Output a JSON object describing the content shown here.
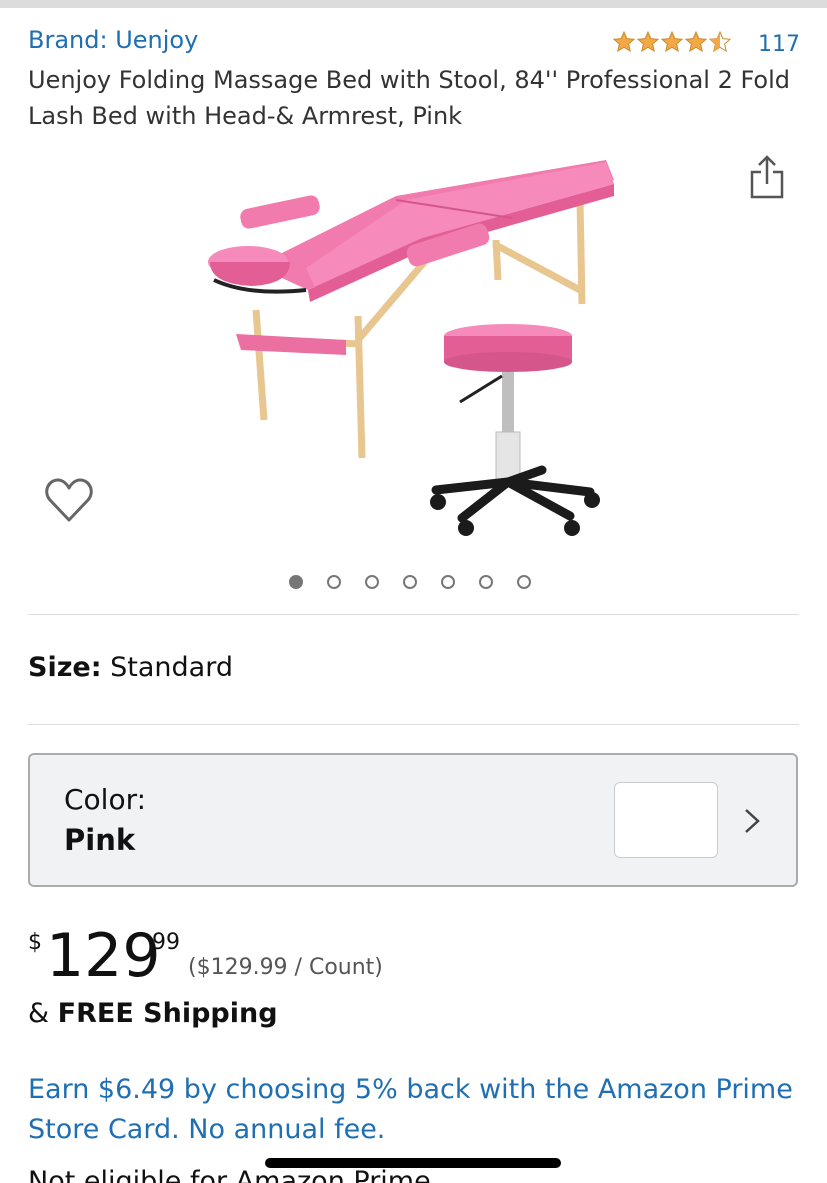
{
  "header": {
    "brand": "Brand: Uenjoy",
    "rating": {
      "stars": 4.5,
      "max": 5,
      "count": "117"
    },
    "title": "Uenjoy Folding Massage Bed with Stool, 84'' Professional 2 Fold Lash Bed with Head-& Armrest, Pink"
  },
  "gallery": {
    "image_count": 7,
    "active_index": 0,
    "icons": {
      "share": "share-icon",
      "wishlist": "heart-icon"
    }
  },
  "size": {
    "label": "Size:",
    "value": "Standard"
  },
  "color": {
    "label": "Color:",
    "value": "Pink"
  },
  "price": {
    "symbol": "$",
    "whole": "129",
    "fraction": "99",
    "unit_price": "($129.99 / Count)"
  },
  "shipping": {
    "prefix": "&",
    "label": "FREE Shipping"
  },
  "promo": "Earn $6.49 by choosing 5% back with the Amazon Prime Store Card. No annual fee.",
  "eligibility": "Not eligible for Amazon Prime",
  "colors": {
    "link": "#1f6fb2",
    "star": "#f3a847",
    "pink": "#f06fa0",
    "selector_bg": "#f0f2f3"
  }
}
